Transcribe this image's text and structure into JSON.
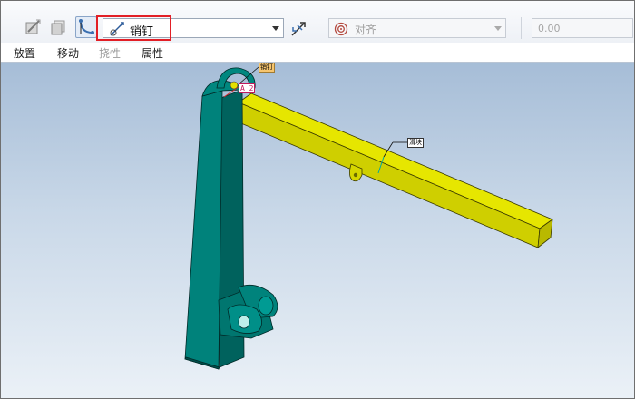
{
  "toolbar": {
    "connection_type": {
      "label": "销钉",
      "icon": "pin-joint-icon"
    },
    "constraint": {
      "label": "对齐",
      "icon": "constraint-target-icon"
    },
    "offset": {
      "value": "0.00"
    },
    "buttons": [
      {
        "icon": "user-defined-set-icon"
      },
      {
        "icon": "component-placement-icon"
      },
      {
        "icon": "mechanism-connection-icon"
      },
      {
        "icon": "flip-constraint-icon"
      }
    ],
    "highlight_color": "#e21f26"
  },
  "tabs": [
    {
      "label": "放置",
      "enabled": true
    },
    {
      "label": "移动",
      "enabled": true
    },
    {
      "label": "挠性",
      "enabled": false
    },
    {
      "label": "属性",
      "enabled": true
    }
  ],
  "viewport": {
    "annotations": {
      "pin_tag": "销钉",
      "axis_tag": "A_2",
      "slide_tag": "滑块"
    },
    "colors": {
      "background_top": "#a6bdd7",
      "background_bottom": "#ebf1f7",
      "arm_part": "#00706a",
      "beam_part": "#d6d600"
    }
  }
}
